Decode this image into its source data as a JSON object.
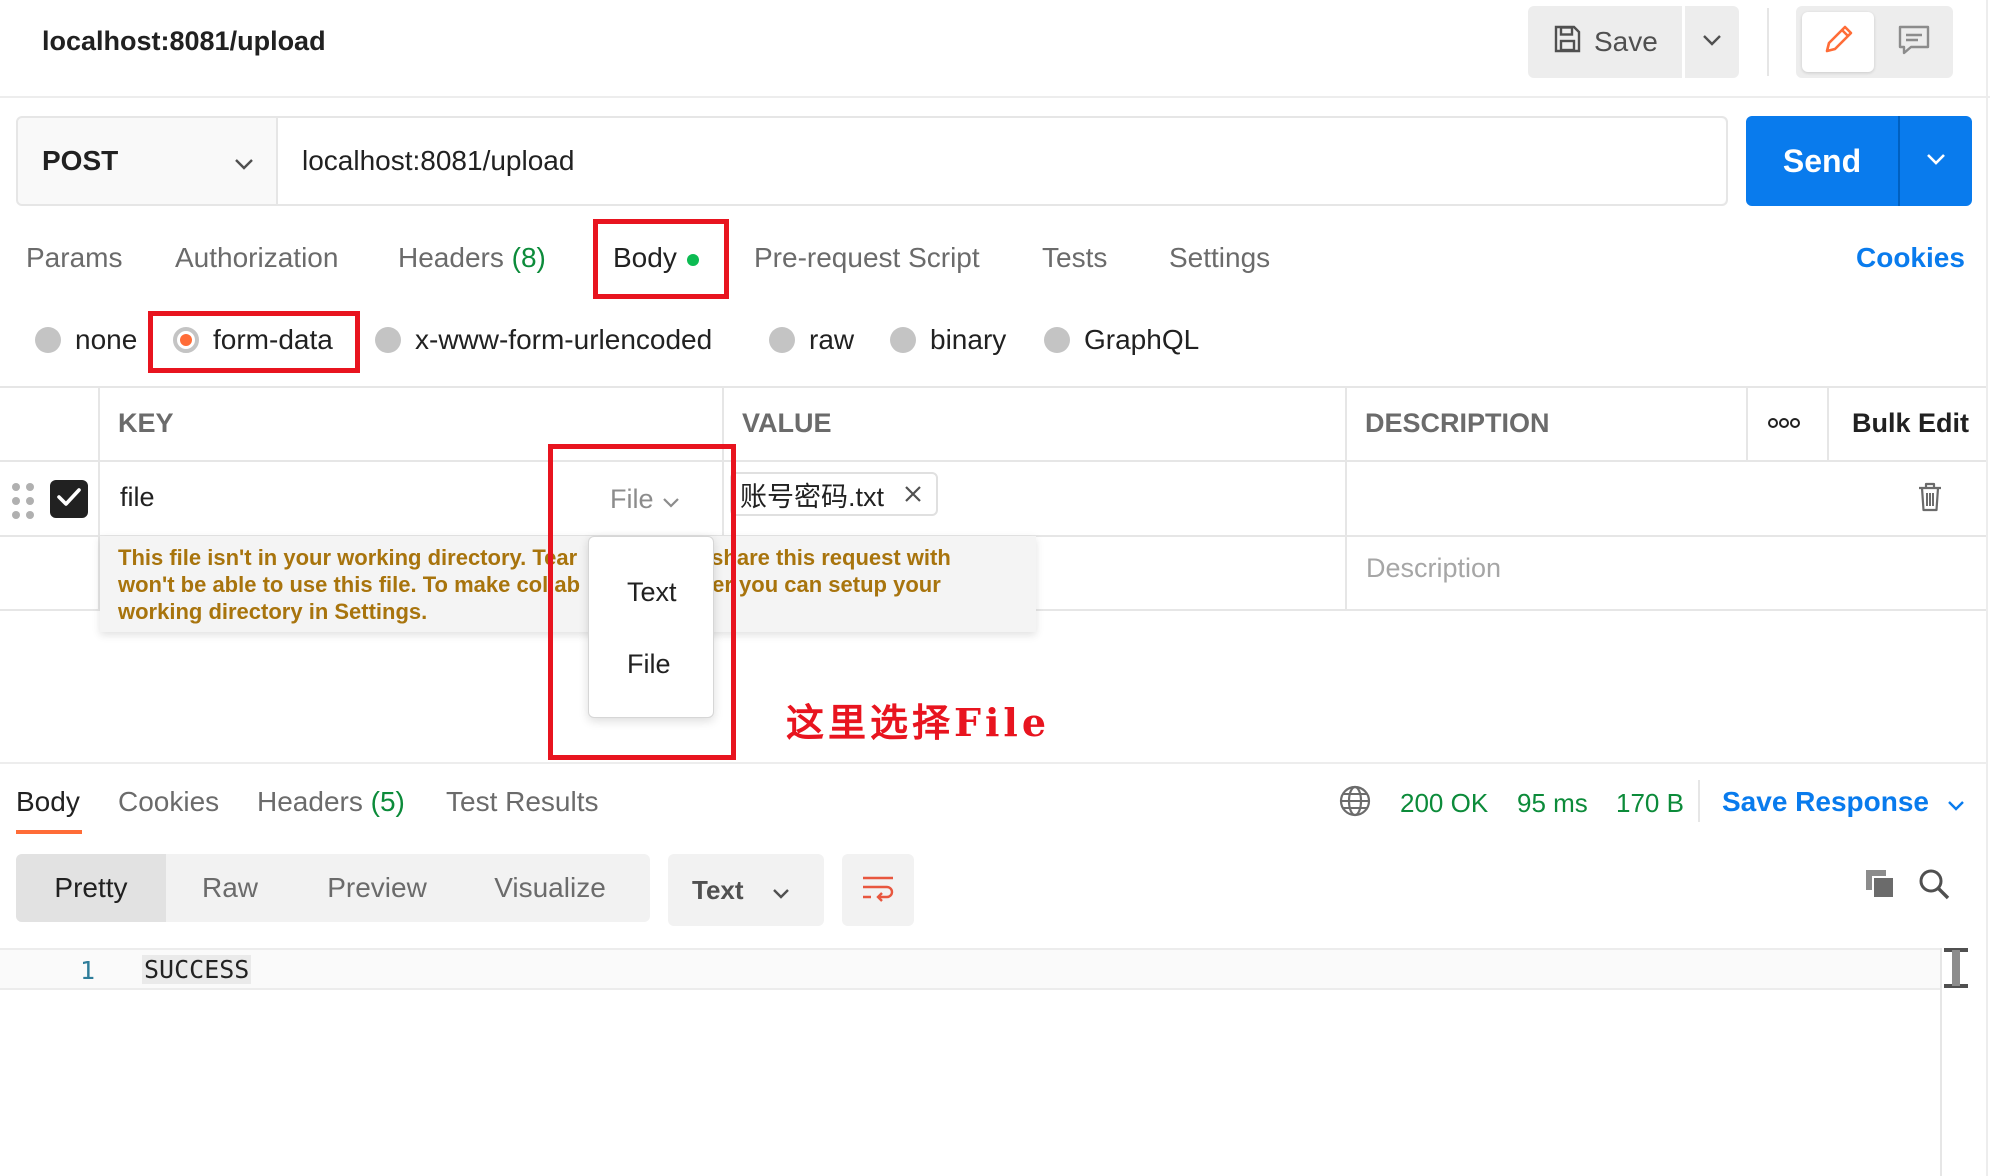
{
  "request_title": "localhost:8081/upload",
  "toolbar": {
    "save_label": "Save"
  },
  "url_bar": {
    "method": "POST",
    "url": "localhost:8081/upload",
    "send_label": "Send"
  },
  "request_tabs": {
    "params": "Params",
    "authorization": "Authorization",
    "headers": "Headers",
    "headers_count": "(8)",
    "body": "Body",
    "prerequest": "Pre-request Script",
    "tests": "Tests",
    "settings": "Settings",
    "cookies": "Cookies"
  },
  "body_types": {
    "none": "none",
    "form_data": "form-data",
    "urlencoded": "x-www-form-urlencoded",
    "raw": "raw",
    "binary": "binary",
    "graphql": "GraphQL",
    "selected": "form-data"
  },
  "params_table": {
    "headers": {
      "key": "KEY",
      "value": "VALUE",
      "description": "DESCRIPTION",
      "bulk_edit": "Bulk Edit"
    },
    "rows": [
      {
        "key": "file",
        "type": "File",
        "value_file": "账号密码.txt",
        "checked": true
      }
    ],
    "new_row": {
      "description_placeholder": "Description"
    }
  },
  "warning": {
    "line1_a": "This file isn't in your working directory. Tear",
    "line1_b": "share this request with",
    "line2_a": "won't be able to use this file. To make collab",
    "line2_b": "ier you can setup your",
    "line3": "working directory in Settings."
  },
  "type_dropdown": {
    "options": [
      "Text",
      "File"
    ]
  },
  "annotation": "这里选择File",
  "response": {
    "tabs": {
      "body": "Body",
      "cookies": "Cookies",
      "headers": "Headers",
      "headers_count": "(5)",
      "test_results": "Test Results"
    },
    "status": "200 OK",
    "time": "95 ms",
    "size": "170 B",
    "save_response": "Save Response",
    "views": {
      "pretty": "Pretty",
      "raw": "Raw",
      "preview": "Preview",
      "visualize": "Visualize"
    },
    "format": "Text",
    "lines": [
      {
        "number": "1",
        "text": "SUCCESS"
      }
    ]
  },
  "colors": {
    "accent_blue": "#097bed",
    "postman_orange": "#ff6c37",
    "status_green": "#0c8b3a",
    "annotation_red": "#e8141f",
    "warning_text": "#a8740d"
  },
  "icons": [
    "save-icon",
    "chevron-down-icon",
    "pencil-icon",
    "comment-icon",
    "drag-handle-icon",
    "checkbox-check-icon",
    "close-icon",
    "trash-icon",
    "more-dots-icon",
    "globe-icon",
    "wrap-lines-icon",
    "copy-icon",
    "search-icon"
  ]
}
